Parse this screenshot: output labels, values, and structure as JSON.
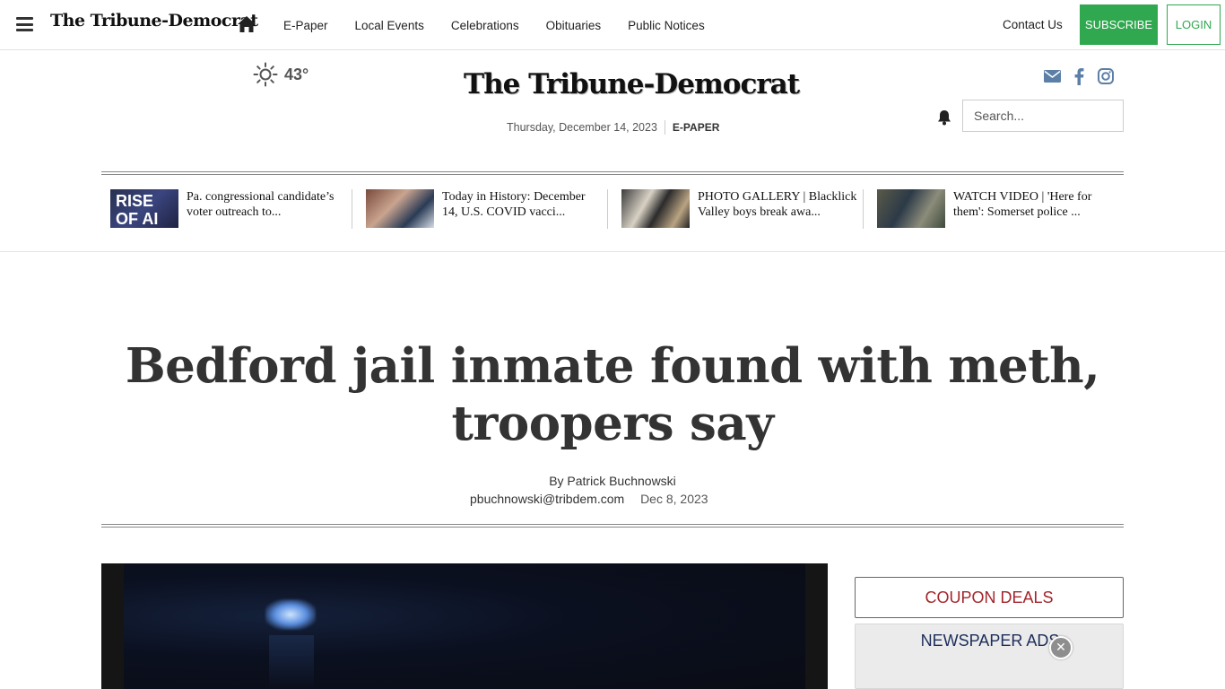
{
  "topbar": {
    "brand": "The Tribune-Democrat",
    "nav": [
      "E-Paper",
      "Local Events",
      "Celebrations",
      "Obituaries",
      "Public Notices"
    ],
    "contact": "Contact Us",
    "subscribe": "SUBSCRIBE",
    "login": "LOGIN"
  },
  "masthead": {
    "weather_temp": "43°",
    "weather_icon": "sun-icon",
    "logo": "The Tribune-Democrat",
    "date": "Thursday, December 14, 2023",
    "epaper": "E-PAPER",
    "social_icons": [
      "email-icon",
      "facebook-icon",
      "instagram-icon"
    ],
    "search_placeholder": "Search..."
  },
  "headline_strip": [
    {
      "thumb_text": "RISE OF AI",
      "title": "Pa. congressional candidate’s voter outreach to..."
    },
    {
      "thumb_text": "",
      "title": "Today in History: December 14, U.S. COVID vacci..."
    },
    {
      "thumb_text": "",
      "title": "PHOTO GALLERY | Blacklick Valley boys break awa..."
    },
    {
      "thumb_text": "",
      "title": "WATCH VIDEO | 'Here for them': Somerset police ..."
    }
  ],
  "article": {
    "headline": "Bedford jail inmate found with meth, troopers say",
    "byline": "By Patrick Buchnowski",
    "email": "pbuchnowski@tribdem.com",
    "date": "Dec 8, 2023"
  },
  "sidebar": {
    "coupon": "COUPON DEALS",
    "newspaper_ads": "NEWSPAPER ADS",
    "close": "✕"
  },
  "colors": {
    "accent_green": "#2fa84f",
    "coupon_red": "#a4252b",
    "ads_navy": "#1c2d5a",
    "social_blue": "#5b7fa6"
  }
}
